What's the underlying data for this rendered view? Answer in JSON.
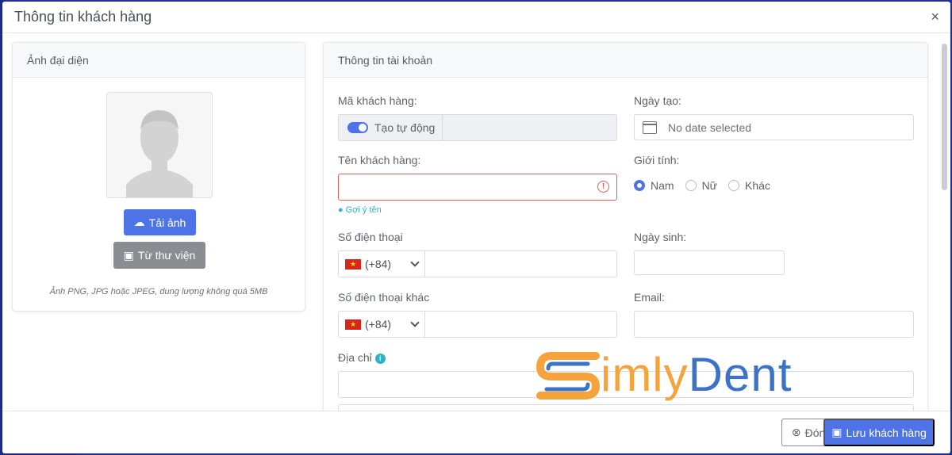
{
  "modal": {
    "title": "Thông tin khách hàng",
    "close_symbol": "×"
  },
  "avatar": {
    "header": "Ảnh đại diện",
    "upload_label": "Tải ảnh",
    "library_label": "Từ thư viện",
    "note": "Ảnh PNG, JPG hoặc JPEG, dung lượng không quá 5MB"
  },
  "account": {
    "header": "Thông tin tài khoản",
    "code_label": "Mã khách hàng:",
    "auto_label": "Tạo tự động",
    "created_label": "Ngày tạo:",
    "created_placeholder": "No date selected",
    "name_label": "Tên khách hàng:",
    "name_value": "",
    "hint": "Gợi ý tên",
    "gender_label": "Giới tính:",
    "gender_options": [
      "Nam",
      "Nữ",
      "Khác"
    ],
    "gender_selected": "Nam",
    "phone_label": "Số điện thoại",
    "phone_code": "(+84)",
    "dob_label": "Ngày sinh:",
    "phone2_label": "Số điện thoại khác",
    "phone2_code": "(+84)",
    "email_label": "Email:",
    "address_label": "Địa chỉ"
  },
  "watermark": {
    "part1": "imly",
    "part2": "Dent"
  },
  "footer": {
    "close_label": "Đóng",
    "save_label": "Lưu khách hàng"
  },
  "colors": {
    "primary": "#4d73e6",
    "secondary": "#8a8d91",
    "error": "#e45b5b",
    "hint": "#2fb2c8",
    "watermark_orange": "#f5a33c",
    "watermark_blue": "#3b73c6"
  }
}
